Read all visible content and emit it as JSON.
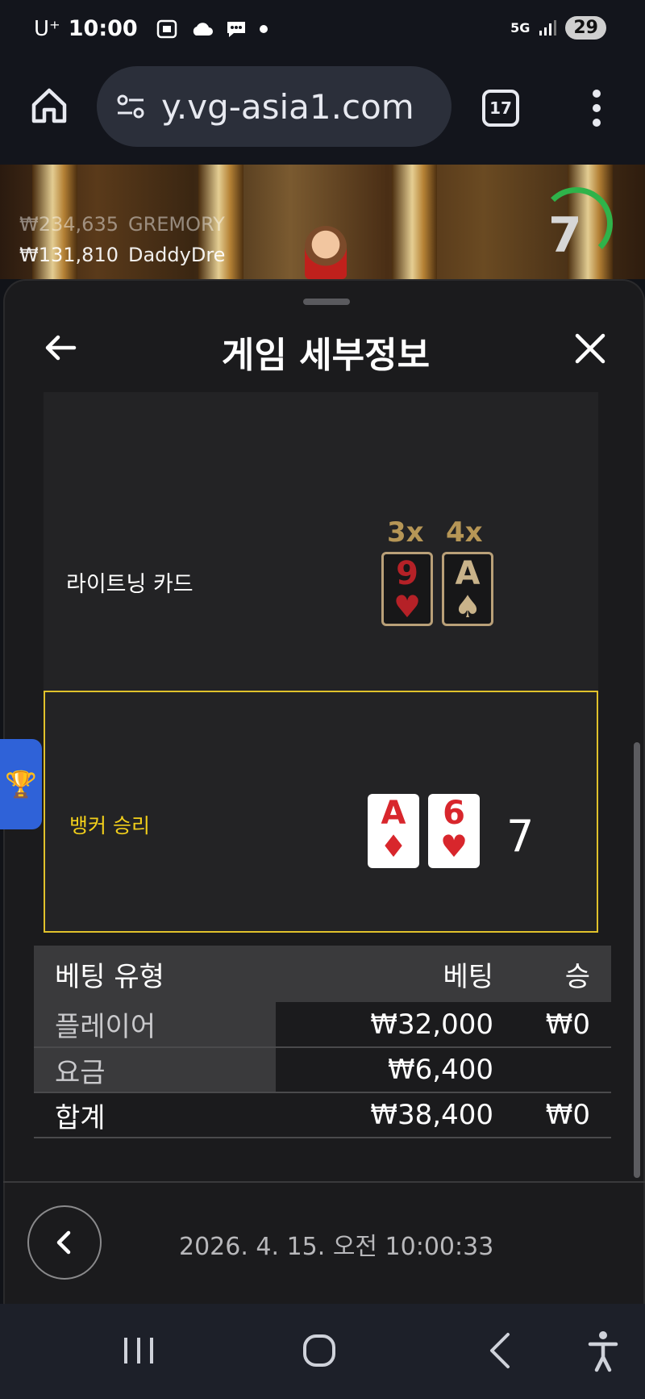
{
  "status_bar": {
    "carrier": "U⁺",
    "time": "10:00",
    "network": "5G",
    "battery": "29"
  },
  "browser": {
    "url": "y.vg-asia1.com",
    "tab_count": "17",
    "icons": [
      "home-icon",
      "tune-icon",
      "tabs-icon",
      "more-vert-icon"
    ]
  },
  "game_strip": {
    "players": [
      {
        "amount": "₩234,635",
        "name": "GREMORY"
      },
      {
        "amount": "₩131,810",
        "name": "DaddyDre"
      }
    ],
    "timer": "7",
    "timer_color": "#2fb34a"
  },
  "sheet": {
    "title": "게임 세부정보"
  },
  "lightning": {
    "label": "라이트닝 카드",
    "cards": [
      {
        "multiplier": "3x",
        "rank": "9",
        "suit": "♥"
      },
      {
        "multiplier": "4x",
        "rank": "A",
        "suit": "♠"
      }
    ]
  },
  "result": {
    "label": "뱅커 승리",
    "label_color": "#f2cf1b",
    "cards": [
      {
        "rank": "A",
        "suit": "♦"
      },
      {
        "rank": "6",
        "suit": "♥"
      }
    ],
    "score": "7"
  },
  "bets": {
    "headers": {
      "type": "베팅 유형",
      "bet": "베팅",
      "win": "승"
    },
    "rows": [
      {
        "type": "플레이어",
        "bet": "₩32,000",
        "win": "₩0"
      },
      {
        "type": "요금",
        "bet": "₩6,400",
        "win": ""
      }
    ],
    "total": {
      "type": "합계",
      "bet": "₩38,400",
      "win": "₩0"
    }
  },
  "footer": {
    "timestamp": "2026. 4. 15. 오전 10:00:33"
  }
}
